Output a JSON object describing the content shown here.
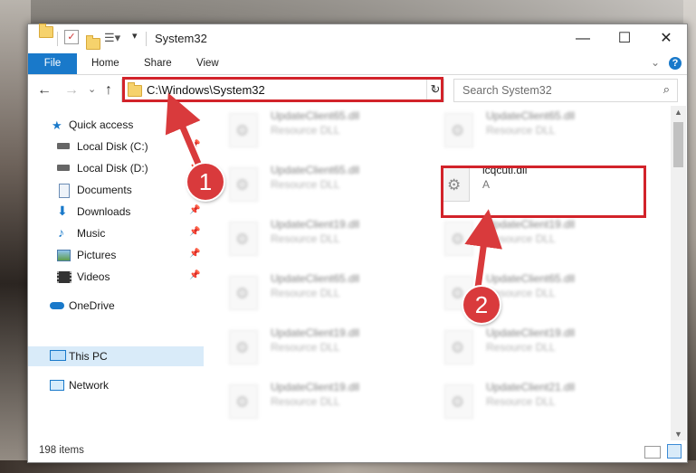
{
  "window": {
    "title": "System32",
    "minimize": "—",
    "maximize": "☐",
    "close": "✕"
  },
  "ribbon": {
    "tabs": [
      "File",
      "Home",
      "Share",
      "View"
    ],
    "help": "?",
    "expand": "⌄"
  },
  "nav": {
    "back": "←",
    "forward": "→",
    "recent": "⌄",
    "up": "↑",
    "address": "C:\\Windows\\System32",
    "address_dropdown": "⌄",
    "refresh": "↻",
    "search_placeholder": "Search System32",
    "search_icon": "⌕"
  },
  "sidebar": {
    "items": [
      {
        "label": "Quick access",
        "icon": "star-icon",
        "pinned": false
      },
      {
        "label": "Local Disk (C:)",
        "icon": "drive-icon",
        "pinned": true
      },
      {
        "label": "Local Disk (D:)",
        "icon": "drive-icon",
        "pinned": true
      },
      {
        "label": "Documents",
        "icon": "document-icon",
        "pinned": true
      },
      {
        "label": "Downloads",
        "icon": "download-icon",
        "pinned": true
      },
      {
        "label": "Music",
        "icon": "music-icon",
        "pinned": true
      },
      {
        "label": "Pictures",
        "icon": "pictures-icon",
        "pinned": true
      },
      {
        "label": "Videos",
        "icon": "videos-icon",
        "pinned": true
      },
      {
        "label": "OneDrive",
        "icon": "cloud-icon",
        "pinned": false
      },
      {
        "label": "This PC",
        "icon": "computer-icon",
        "pinned": false,
        "selected": true
      },
      {
        "label": "Network",
        "icon": "network-icon",
        "pinned": false
      }
    ],
    "pin_glyph": "📌"
  },
  "files": [
    {
      "name": "UpdateClient65.dll",
      "type": "Resource DLL"
    },
    {
      "name": "UpdateClient65.dll",
      "type": "Resource DLL"
    },
    {
      "name": "UpdateClient65.dll",
      "type": "Resource DLL"
    },
    {
      "name": "icqcutl.dll",
      "type": "A",
      "highlighted": true
    },
    {
      "name": "UpdateClient19.dll",
      "type": "Resource DLL"
    },
    {
      "name": "UpdateClient19.dll",
      "type": "Resource DLL"
    },
    {
      "name": "UpdateClient65.dll",
      "type": "Resource DLL"
    },
    {
      "name": "UpdateClient65.dll",
      "type": "Resource DLL"
    },
    {
      "name": "UpdateClient19.dll",
      "type": "Resource DLL"
    },
    {
      "name": "UpdateClient19.dll",
      "type": "Resource DLL"
    },
    {
      "name": "UpdateClient19.dll",
      "type": "Resource DLL"
    },
    {
      "name": "UpdateClient21.dll",
      "type": "Resource DLL"
    }
  ],
  "status": {
    "item_count": "198 items"
  },
  "annotations": {
    "step1": "1",
    "step2": "2",
    "color": "#d2232a"
  }
}
